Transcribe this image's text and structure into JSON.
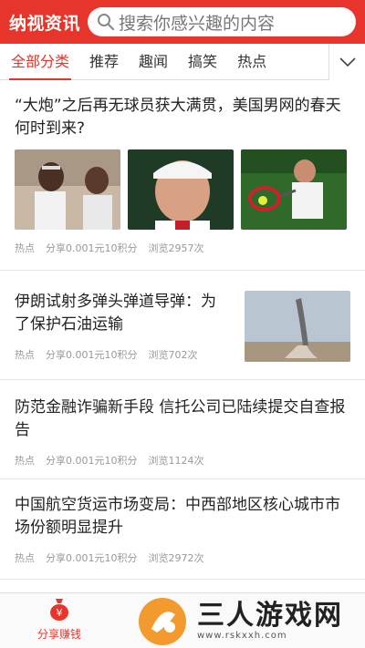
{
  "header": {
    "brand": "纳视资讯",
    "search_placeholder": "搜索你感兴趣的内容",
    "accent": "#e8352b"
  },
  "tabs": [
    {
      "label": "全部分类",
      "active": true
    },
    {
      "label": "推荐",
      "active": false
    },
    {
      "label": "趣闻",
      "active": false
    },
    {
      "label": "搞笑",
      "active": false
    },
    {
      "label": "热点",
      "active": false
    }
  ],
  "tabs_more_icon": "chevron-down-icon",
  "articles": [
    {
      "title": "“大炮”之后再无球员获大满贯，美国男网的春天何时到来?",
      "category": "热点",
      "share": "分享0.001元10积分",
      "views": "浏览2957次",
      "layout": "three-images"
    },
    {
      "title": "伊朗试射多弹头弹道导弹：为了保护石油运输",
      "category": "热点",
      "share": "分享0.001元10积分",
      "views": "浏览702次",
      "layout": "right-image"
    },
    {
      "title": "防范金融诈骗新手段 信托公司已陆续提交自查报告",
      "category": "热点",
      "share": "分享0.001元10积分",
      "views": "浏览1124次",
      "layout": "text"
    },
    {
      "title": "中国航空货运市场变局：中西部地区核心城市市场份额明显提升",
      "category": "热点",
      "share": "分享0.001元10积分",
      "views": "浏览2972次",
      "layout": "text"
    }
  ],
  "bottom_nav": {
    "label": "分享赚钱",
    "icon": "money-bag-icon"
  },
  "watermark": {
    "text": "三人游戏网",
    "url": "www.rskxxh.com"
  }
}
